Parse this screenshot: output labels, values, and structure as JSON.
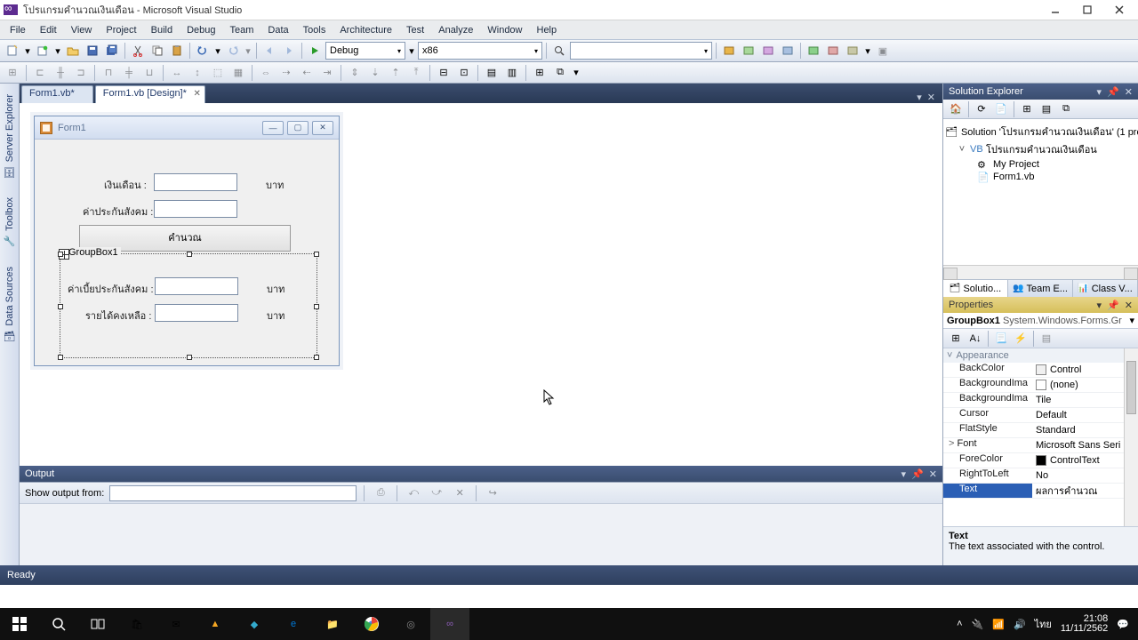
{
  "app": {
    "title": "โปรแกรมคำนวณเงินเดือน - Microsoft Visual Studio"
  },
  "menus": [
    "File",
    "Edit",
    "View",
    "Project",
    "Build",
    "Debug",
    "Team",
    "Data",
    "Tools",
    "Architecture",
    "Test",
    "Analyze",
    "Window",
    "Help"
  ],
  "toolbar": {
    "config": "Debug",
    "platform": "x86"
  },
  "tabs": [
    {
      "label": "Form1.vb*",
      "active": false
    },
    {
      "label": "Form1.vb [Design]*",
      "active": true
    }
  ],
  "sidetabs": [
    "Server Explorer",
    "Toolbox",
    "Data Sources"
  ],
  "form": {
    "title": "Form1",
    "labels": {
      "salary": "เงินเดือน :",
      "social": "ค่าประกันสังคม :",
      "premium": "ค่าเบี้ยประกันสังคม :",
      "net": "รายได้คงเหลือ :",
      "unit": "บาท"
    },
    "button": "คำนวณ",
    "groupbox": "GroupBox1"
  },
  "output": {
    "title": "Output",
    "showfrom": "Show output from:"
  },
  "status": "Ready",
  "solution": {
    "title": "Solution Explorer",
    "root": "Solution 'โปรแกรมคำนวณเงินเดือน' (1 pro",
    "project": "โปรแกรมคำนวณเงินเดือน",
    "items": [
      "My Project",
      "Form1.vb"
    ],
    "subtabs": [
      "Solutio...",
      "Team E...",
      "Class V..."
    ]
  },
  "properties": {
    "title": "Properties",
    "object": "GroupBox1",
    "objectType": "System.Windows.Forms.Gr",
    "category": "Appearance",
    "rows": [
      {
        "name": "BackColor",
        "value": "Control",
        "swatch": "#f0f0f0"
      },
      {
        "name": "BackgroundIma",
        "value": "(none)",
        "swatch": "#ffffff"
      },
      {
        "name": "BackgroundIma",
        "value": "Tile"
      },
      {
        "name": "Cursor",
        "value": "Default"
      },
      {
        "name": "FlatStyle",
        "value": "Standard"
      },
      {
        "name": "Font",
        "value": "Microsoft Sans Seri",
        "expandable": true
      },
      {
        "name": "ForeColor",
        "value": "ControlText",
        "swatch": "#000000"
      },
      {
        "name": "RightToLeft",
        "value": "No"
      },
      {
        "name": "Text",
        "value": "ผลการคำนวณ",
        "selected": true
      }
    ],
    "desc": {
      "title": "Text",
      "body": "The text associated with the control."
    }
  },
  "tray": {
    "lang": "ไทย",
    "time": "21:08",
    "date": "11/11/2562"
  }
}
